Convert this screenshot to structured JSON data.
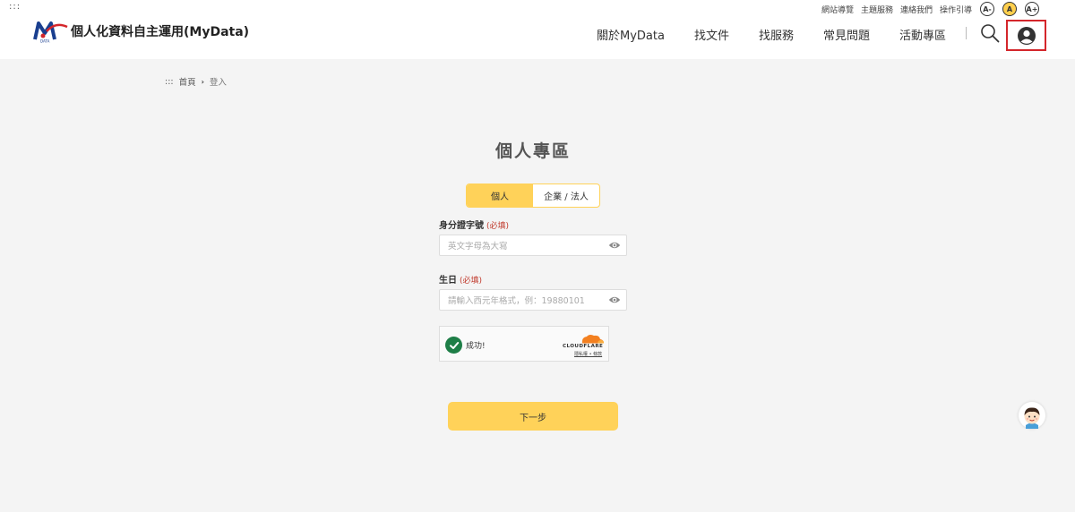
{
  "header": {
    "accesskey": ":::",
    "site_title": "個人化資料自主運用(MyData)",
    "top_links": [
      "網站導覽",
      "主題服務",
      "連絡我們",
      "操作引導"
    ],
    "font_sizes": [
      "A-",
      "A",
      "A+"
    ],
    "nav": [
      "關於MyData",
      "找文件",
      "找服務",
      "常見問題",
      "活動專區"
    ],
    "search_icon": "search-icon",
    "user_icon": "user-circle-icon"
  },
  "breadcrumb": {
    "accesskey": ":::",
    "home": "首頁",
    "current": "登入"
  },
  "page": {
    "title": "個人專區",
    "tabs": [
      {
        "label": "個人",
        "active": true
      },
      {
        "label": "企業 / 法人",
        "active": false
      }
    ]
  },
  "form": {
    "id_label": "身分證字號",
    "id_required": "(必填)",
    "id_placeholder": "英文字母為大寫",
    "birth_label": "生日",
    "birth_required": "(必填)",
    "birth_placeholder": "請輸入西元年格式，例：19880101",
    "eye_icon": "eye-icon"
  },
  "captcha": {
    "status": "成功!",
    "brand": "CLOUDFLARE",
    "links": "隱私權 • 條款"
  },
  "actions": {
    "next": "下一步"
  },
  "colors": {
    "accent": "#ffd259",
    "highlight_border": "#d4262b",
    "success": "#1e7e47",
    "required": "#c0392b"
  }
}
